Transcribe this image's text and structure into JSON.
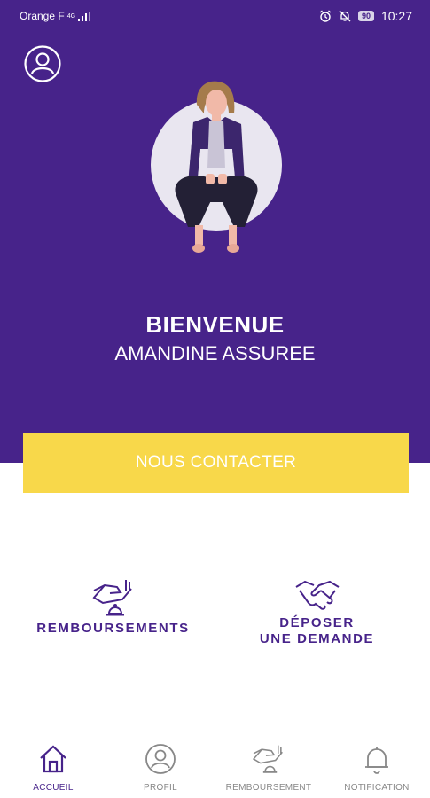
{
  "status_bar": {
    "carrier": "Orange F",
    "network": "4G",
    "battery": "90",
    "time": "10:27"
  },
  "header": {
    "profile_icon": "user-circle-icon"
  },
  "welcome": {
    "title": "BIENVENUE",
    "name": "AMANDINE ASSUREE"
  },
  "contact_button": {
    "label": "NOUS CONTACTER"
  },
  "actions": [
    {
      "label": "REMBOURSEMENTS",
      "icon": "hand-coin-icon"
    },
    {
      "label_line1": "DÉPOSER",
      "label_line2": "UNE DEMANDE",
      "icon": "handshake-icon"
    }
  ],
  "nav": [
    {
      "label": "ACCUEIL",
      "icon": "home-icon",
      "active": true
    },
    {
      "label": "PROFIL",
      "icon": "user-circle-icon",
      "active": false
    },
    {
      "label": "REMBOURSEMENT",
      "icon": "hand-coin-icon",
      "active": false
    },
    {
      "label": "NOTIFICATION",
      "icon": "bell-icon",
      "active": false
    }
  ],
  "colors": {
    "primary": "#47238a",
    "accent": "#f8d84a",
    "inactive": "#888888"
  }
}
